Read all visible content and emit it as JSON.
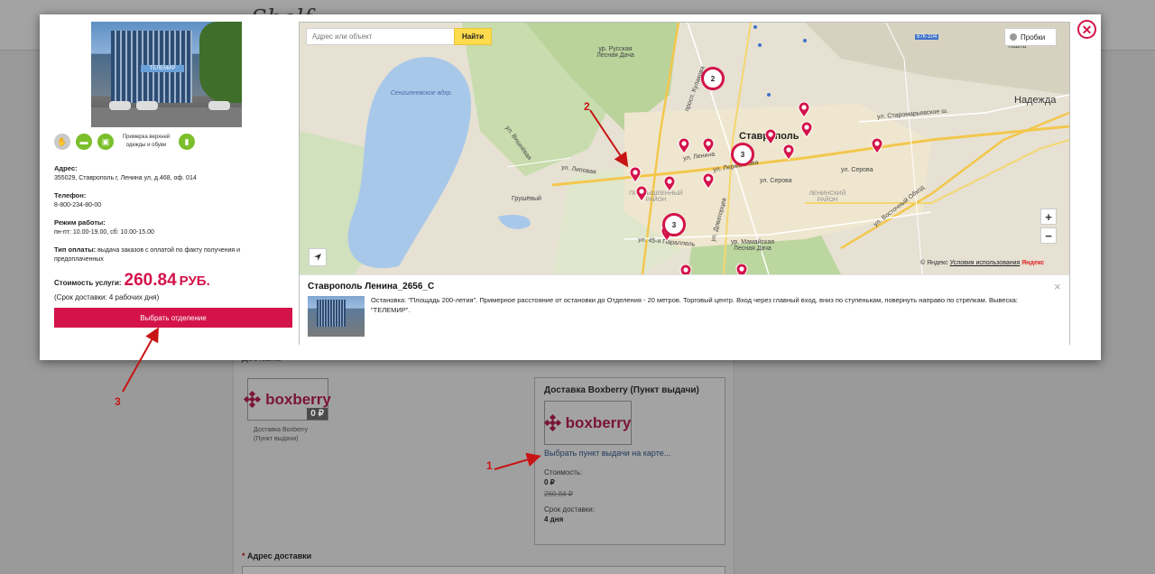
{
  "background": {
    "logo_text": "Shelf",
    "section_title": "Доставка",
    "boxberry_logo": "boxberry",
    "zero_badge": "0 ₽",
    "small_caption_line1": "Доставка Boxberry",
    "small_caption_line2": "(Пункт выдачи)",
    "delivery_card": {
      "title": "Доставка Boxberry (Пункт выдачи)",
      "map_link": "Выбрать пункт выдачи на карте...",
      "cost_label": "Стоимость:",
      "cost_value": "0 ₽",
      "cost_old": "260.84 ₽",
      "term_label": "Срок доставки:",
      "term_value": "4 дня"
    },
    "address_label": "Адрес доставки",
    "address_required_mark": "*"
  },
  "modal": {
    "close_symbol": "✕",
    "photo_sign": "ТЕЛЕМИР",
    "service_icons": [
      "walk-icon",
      "card-icon",
      "wallet-icon",
      "shirt-icon"
    ],
    "fitting_text_line1": "Примерка верхней",
    "fitting_text_line2": "одежды и обуви",
    "address_label": "Адрес:",
    "address_value": "355029, Ставрополь г, Ленина ул, д.468, оф. 014",
    "phone_label": "Телефон:",
    "phone_value": "8-800-234-80-00",
    "hours_label": "Режим работы:",
    "hours_value": "пн-пт: 10.00-19.00, сб: 10.00-15.00",
    "payment_label": "Тип оплаты:",
    "payment_value": "выдача заказов с оплатой по факту получения и предоплаченных",
    "cost_label": "Стоимость услуги:",
    "cost_value": "260.84",
    "cost_currency": "РУБ.",
    "term_text": "(Срок доставки: 4 рабочих дня)",
    "choose_button": "Выбрать отделение"
  },
  "map": {
    "search_placeholder": "Адрес или объект",
    "search_button": "Найти",
    "traffic_button": "Пробки",
    "zoom_in": "+",
    "zoom_out": "−",
    "copyright_prefix": "© Яндекс",
    "terms_link": "Условия использования",
    "yandex_brand": "Яндекс",
    "labels": {
      "city": "Ставрополь",
      "nadezhda": "Надежда",
      "tashla": "Ташла",
      "russkaya": "ур. Русская Лесная Дача",
      "sengileev": "Сенгилеевское вдхр.",
      "grushevy": "Грушёвый",
      "promyshlenny": "ПРОМЫШЛЕННЫЙ РАЙОН",
      "leninsky": "ЛЕНИНСКИЙ РАЙОН",
      "mamayskaya": "ур. Мамайская Лесная Дача",
      "road_67k": "67К-104",
      "ul_lenina": "ул. Ленина",
      "ul_serova": "ул. Серова",
      "ul_vostochny": "ул. Восточный Обход",
      "staromar": "ул. Старомарьевское ш.",
      "parallel": "ул. 45-я Параллель",
      "dovatortsev": "ул. Доваторцев",
      "lipovaya": "ул. Липовая",
      "vishnyovaya": "ул. Вишнёвая",
      "permontova": "ул. Лермонтова",
      "kulakova": "просп. Кулакова"
    },
    "clusters": [
      "2",
      "3",
      "3"
    ]
  },
  "popup": {
    "title": "Ставрополь Ленина_2656_С",
    "close_symbol": "×",
    "description": "Остановка: \"Площадь 200-летия\". Примерное расстояние от остановки до Отделения - 20 метров. Торговый центр. Вход через главный вход, вниз по ступенькам, повернуть направо по стрелкам. Вывеска: \"ТЕЛЕМИР\"."
  },
  "annotations": [
    "1",
    "2",
    "3"
  ],
  "colors": {
    "accent": "#d3134a",
    "search_button": "#ffdb4d",
    "annotation": "#c81414"
  }
}
